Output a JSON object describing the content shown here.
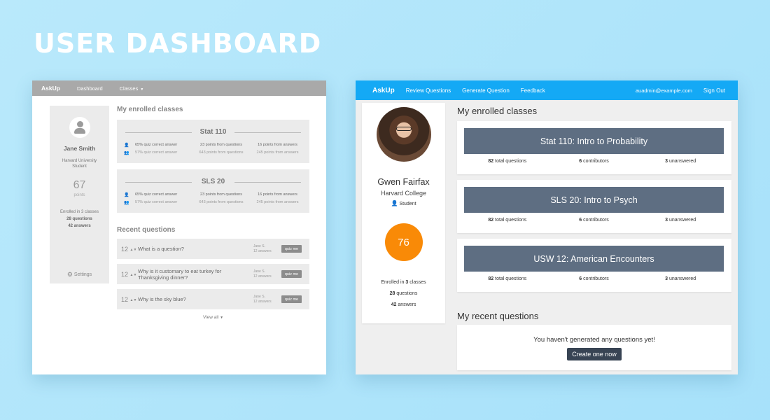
{
  "hero": {
    "title": "USER DASHBOARD"
  },
  "wireframe": {
    "nav": {
      "brand": "AskUp",
      "dashboard": "Dashboard",
      "classes": "Classes"
    },
    "profile": {
      "name": "Jane Smith",
      "school": "Harvard University",
      "role": "Student",
      "points": "67",
      "points_label": "points",
      "enrolled": "Enrolled in 3 classes",
      "questions": "28 questions",
      "answers": "42 answers",
      "settings": "Settings"
    },
    "enrolled_heading": "My enrolled classes",
    "classes": [
      {
        "title": "Stat 110",
        "r1c1": "65% quiz correct answer",
        "r1c2": "23 points from questions",
        "r1c3": "16 points from answers",
        "r2c1": "57% quiz correct answer",
        "r2c2": "643 points from questions",
        "r2c3": "245 points from answers"
      },
      {
        "title": "SLS 20",
        "r1c1": "65% quiz correct answer",
        "r1c2": "23 points from questions",
        "r1c3": "16 points from answers",
        "r2c1": "57% quiz correct answer",
        "r2c2": "643 points from questions",
        "r2c3": "245 points from answers"
      }
    ],
    "recent_heading": "Recent questions",
    "questions": [
      {
        "votes": "12",
        "text": "What is a question?",
        "author": "Jane S.",
        "answers": "12 answers",
        "quiz": "quiz me"
      },
      {
        "votes": "12",
        "text": "Why is it customary to eat turkey for Thanksgiving dinner?",
        "author": "Jane S.",
        "answers": "12 answers",
        "quiz": "quiz me"
      },
      {
        "votes": "12",
        "text": "Why is the sky blue?",
        "author": "Jane S.",
        "answers": "12 answers",
        "quiz": "quiz me"
      }
    ],
    "view_all": "View all"
  },
  "final": {
    "nav": {
      "brand": "AskUp",
      "review": "Review Questions",
      "generate": "Generate Question",
      "feedback": "Feedback",
      "email": "auadmin@example.com",
      "signout": "Sign Out"
    },
    "profile": {
      "name": "Gwen Fairfax",
      "school": "Harvard College",
      "role": "Student",
      "score": "76",
      "enrolled_pre": "Enrolled in ",
      "enrolled_num": "3",
      "enrolled_post": " classes",
      "questions_num": "28",
      "questions_label": " questions",
      "answers_num": "42",
      "answers_label": " answers"
    },
    "enrolled_heading": "My enrolled classes",
    "classes": [
      {
        "name": "Stat 110: Intro to Probability",
        "total": "82",
        "total_label": " total questions",
        "contrib": "6",
        "contrib_label": " contributors",
        "unans": "3",
        "unans_label": " unanswered"
      },
      {
        "name": "SLS 20: Intro to Psych",
        "total": "82",
        "total_label": " total questions",
        "contrib": "6",
        "contrib_label": " contributors",
        "unans": "3",
        "unans_label": " unanswered"
      },
      {
        "name": "USW 12: American Encounters",
        "total": "82",
        "total_label": " total questions",
        "contrib": "6",
        "contrib_label": " contributors",
        "unans": "3",
        "unans_label": " unanswered"
      }
    ],
    "recent_heading": "My recent questions",
    "empty_text": "You haven't generated any questions yet!",
    "create_button": "Create one now"
  },
  "colors": {
    "nav_blue": "#14a9f5",
    "class_button": "#5e6e82",
    "score_orange": "#f98a07",
    "create_button": "#384454"
  }
}
